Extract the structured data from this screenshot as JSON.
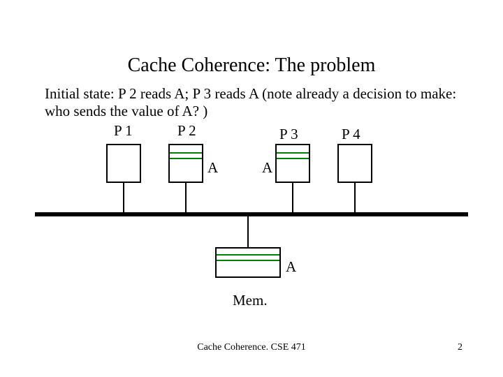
{
  "title": "Cache Coherence: The problem",
  "subtitle": "Initial state: P 2 reads A; P 3 reads A (note already a decision to make: who sends the value of A? )",
  "processors": {
    "p1": "P 1",
    "p2": "P 2",
    "p3": "P 3",
    "p4": "P 4"
  },
  "cache_entry": "A",
  "memory_entry": "A",
  "memory_label": "Mem.",
  "footer_center": "Cache Coherence.  CSE 471",
  "footer_page": "2"
}
